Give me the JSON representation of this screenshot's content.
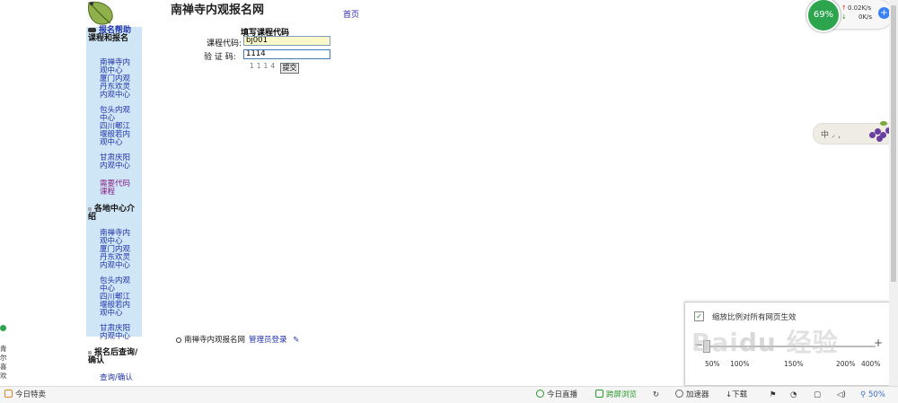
{
  "site": {
    "title": "南禅寺内观报名网",
    "home_link": "首页"
  },
  "sidebar": {
    "section1_title": "报名帮助",
    "section2_title": "课程和报名",
    "course_links": [
      "南禅寺内观中心",
      "厦门内观",
      "丹东欢灵内观中心",
      "包头内观中心",
      "四川郫江堰般若内观中心",
      "甘肃庆阳内观中心"
    ],
    "code_link": "需要代码课程",
    "section3_title": "各地中心介绍",
    "center_links": [
      "南禅寺内观中心",
      "厦门内观",
      "丹东欢灵内观中心",
      "包头内观中心",
      "四川郫江堰般若内观中心",
      "甘肃庆阳内观中心"
    ],
    "section4_title": "报名后查询/确认",
    "query_link": "查询/确认"
  },
  "form": {
    "title": "填写课程代码",
    "code_label": "课程代码:",
    "code_value": "bj001",
    "captcha_label": "验 证 码:",
    "captcha_value": "1114",
    "captcha_image_text": "1114",
    "submit_label": "提交"
  },
  "footer": {
    "text": "南禅寺内观报名网",
    "admin_link": "管理员登录"
  },
  "speed_widget": {
    "percent": "69%",
    "up": "0.02K/s",
    "down": "0K/s",
    "plus": "+"
  },
  "ime": {
    "text": "中 ⸝ ,"
  },
  "zoom_panel": {
    "checkbox_label": "缩放比例对所有网页生效",
    "checked": true,
    "ticks": [
      "50%",
      "100%",
      "150%",
      "200%",
      "400%"
    ],
    "current": "50%"
  },
  "left_edge": {
    "text": "青尔喜欢"
  },
  "statusbar": {
    "today_special": "今日特卖",
    "live": "今日直播",
    "cross_browse": "跨屏浏览",
    "accelerator": "加速器",
    "download": "下载",
    "zoom": "50%"
  },
  "colors": {
    "sidebar_bg": "#cfe6f6",
    "link": "#2233aa",
    "accent_green": "#2da44e"
  }
}
